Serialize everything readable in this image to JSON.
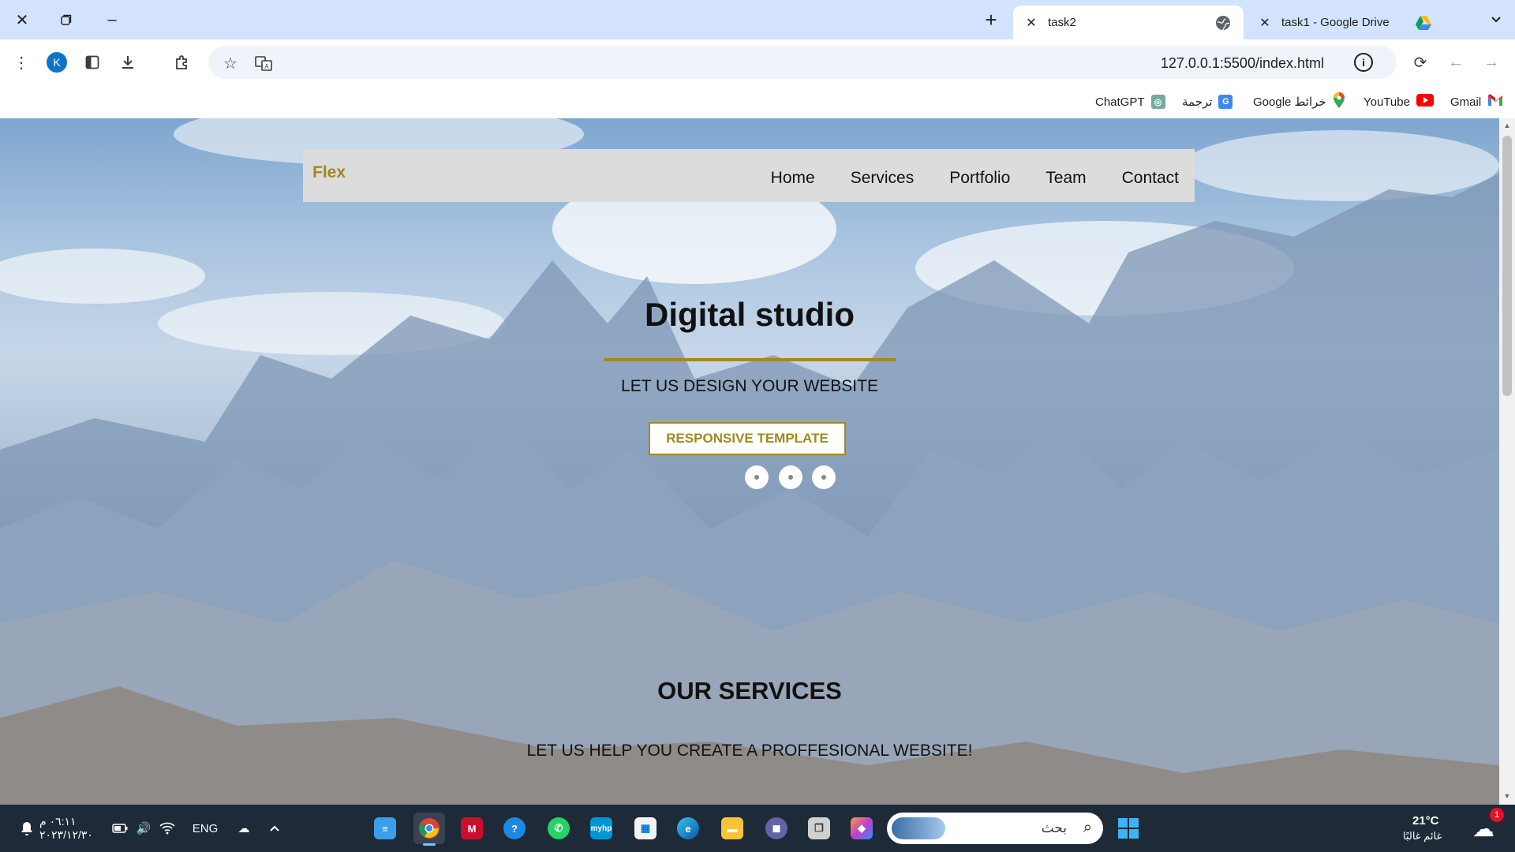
{
  "browser": {
    "tabs": [
      {
        "title": "task2",
        "active": true
      },
      {
        "title": "task1 - Google Drive",
        "active": false
      }
    ],
    "url": "127.0.0.1:5500/index.html",
    "profile_initial": "K",
    "bookmarks": [
      "ChatGPT",
      "ترجمة",
      "Google خرائط",
      "YouTube",
      "Gmail"
    ]
  },
  "site": {
    "brand": "Flex",
    "nav": [
      "Home",
      "Services",
      "Portfolio",
      "Team",
      "Contact"
    ],
    "hero": {
      "title": "Digital studio",
      "subtitle": "LET US DESIGN YOUR WEBSITE",
      "button": "RESPONSIVE TEMPLATE"
    },
    "services": {
      "title": "OUR SERVICES",
      "subtitle": "LET US HELP YOU CREATE A PROFFESIONAL WEBSITE!"
    },
    "accent_color": "#a08a1c"
  },
  "taskbar": {
    "time": "٠٦:١١ م",
    "date": "٢٠٢٣/١٢/٣٠",
    "language": "ENG",
    "search_placeholder": "بحث",
    "weather_temp": "21°C",
    "weather_desc": "غائم غالبًا",
    "notification_count": "1"
  }
}
